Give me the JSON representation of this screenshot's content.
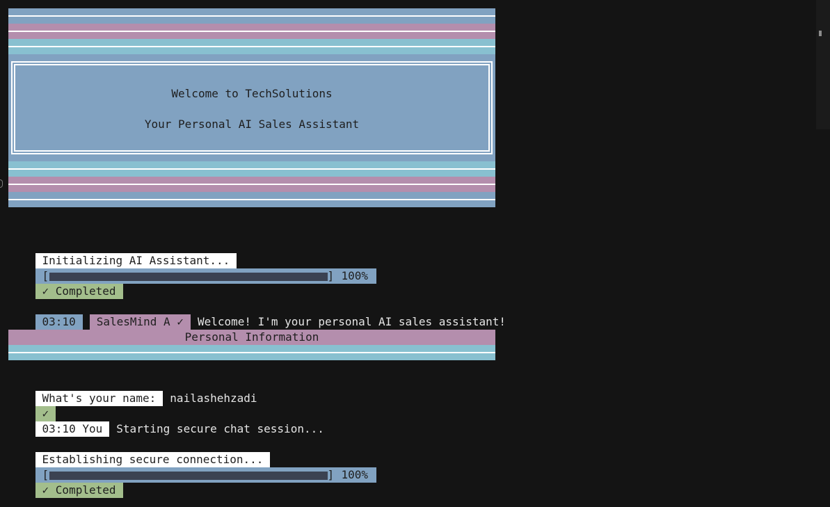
{
  "banner": {
    "title": "Welcome to TechSolutions",
    "subtitle": "Your Personal AI Sales Assistant"
  },
  "init": {
    "label": "Initializing AI Assistant...",
    "bracket_left": "[",
    "bracket_right": "]",
    "progress_percent": 100,
    "percent_text": "100%",
    "status": "✓ Completed"
  },
  "bot_message": {
    "time": "03:10",
    "sender": "SalesMind A ✓",
    "text": "Welcome! I'm your personal AI sales assistant!"
  },
  "section": {
    "title": "Personal Information"
  },
  "name_prompt": {
    "label": "What's your name:",
    "value": "nailashehzadi",
    "check": "✓"
  },
  "user_message": {
    "time_sender": "03:10 You",
    "text": "Starting secure chat session..."
  },
  "connect": {
    "label": "Establishing secure connection...",
    "bracket_left": "[",
    "bracket_right": "]",
    "progress_percent": 100,
    "percent_text": "100%",
    "status": "✓ Completed"
  },
  "colors": {
    "background": "#141414",
    "blue": "#81a2c1",
    "pink": "#b48ead",
    "cyan": "#88c0d0",
    "green": "#a3be8c",
    "white": "#ffffff"
  }
}
